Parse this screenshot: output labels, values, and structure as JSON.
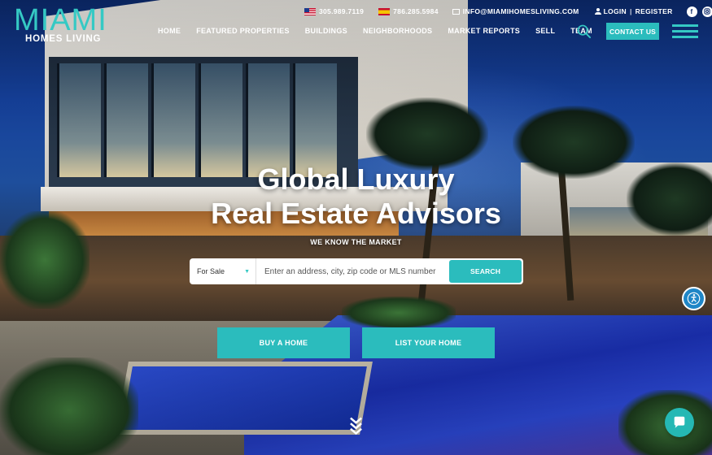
{
  "brand": {
    "logo_main": "MIAMI",
    "logo_sub": "HOMES LIVING",
    "accent_color": "#2bbcbd"
  },
  "topbar": {
    "phone_us": "305.989.7119",
    "phone_es": "786.285.5984",
    "email": "INFO@MIAMIHOMESLIVING.COM",
    "login": "LOGIN",
    "separator": "|",
    "register": "REGISTER",
    "social_icons": [
      "facebook-icon",
      "instagram-icon",
      "linkedin-icon"
    ]
  },
  "nav": {
    "items": [
      "HOME",
      "FEATURED PROPERTIES",
      "BUILDINGS",
      "NEIGHBORHOODS",
      "MARKET REPORTS",
      "SELL",
      "TEAM"
    ],
    "contact_label": "CONTACT US"
  },
  "hero": {
    "title_line1": "Global Luxury",
    "title_line2": "Real Estate Advisors",
    "tagline": "WE KNOW THE MARKET"
  },
  "search": {
    "selected": "For Sale",
    "placeholder": "Enter an address, city, zip code or MLS number",
    "button": "SEARCH"
  },
  "cta": {
    "buy": "BUY A HOME",
    "list": "LIST YOUR HOME"
  }
}
